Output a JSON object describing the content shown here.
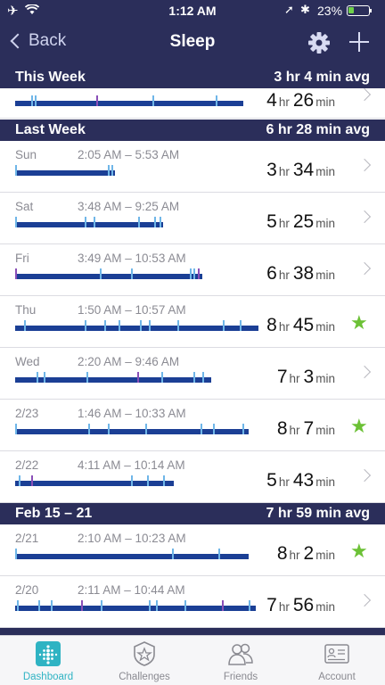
{
  "status_bar": {
    "time": "1:12 AM",
    "battery_pct": "23%",
    "battery_level": 0.23
  },
  "nav": {
    "back_label": "Back",
    "title": "Sleep"
  },
  "this_week": {
    "label": "This Week",
    "avg": "3 hr 4 min avg",
    "row": {
      "hours": "4",
      "minutes": "26"
    }
  },
  "last_week": {
    "label": "Last Week",
    "avg": "6 hr 28 min avg",
    "rows": [
      {
        "day": "Sun",
        "range": "2:05 AM – 5:53 AM",
        "hours": "3",
        "minutes": "34",
        "star": false
      },
      {
        "day": "Sat",
        "range": "3:48 AM – 9:25 AM",
        "hours": "5",
        "minutes": "25",
        "star": false
      },
      {
        "day": "Fri",
        "range": "3:49 AM – 10:53 AM",
        "hours": "6",
        "minutes": "38",
        "star": false
      },
      {
        "day": "Thu",
        "range": "1:50 AM – 10:57 AM",
        "hours": "8",
        "minutes": "45",
        "star": true
      },
      {
        "day": "Wed",
        "range": "2:20 AM – 9:46 AM",
        "hours": "7",
        "minutes": "3",
        "star": false
      },
      {
        "day": "2/23",
        "range": "1:46 AM – 10:33 AM",
        "hours": "8",
        "minutes": "7",
        "star": true
      },
      {
        "day": "2/22",
        "range": "4:11 AM – 10:14 AM",
        "hours": "5",
        "minutes": "43",
        "star": false
      }
    ]
  },
  "feb_week": {
    "label": "Feb 15 – 21",
    "avg": "7 hr 59 min avg",
    "rows": [
      {
        "day": "2/21",
        "range": "2:10 AM – 10:23 AM",
        "hours": "8",
        "minutes": "2",
        "star": true
      },
      {
        "day": "2/20",
        "range": "2:11 AM – 10:44 AM",
        "hours": "7",
        "minutes": "56",
        "star": false
      }
    ]
  },
  "units": {
    "hr": "hr",
    "min": "min"
  },
  "tabs": [
    {
      "label": "Dashboard",
      "icon": "dashboard-icon",
      "active": true
    },
    {
      "label": "Challenges",
      "icon": "challenges-badge-icon",
      "active": false
    },
    {
      "label": "Friends",
      "icon": "friends-icon",
      "active": false
    },
    {
      "label": "Account",
      "icon": "account-card-icon",
      "active": false
    }
  ],
  "colors": {
    "nav": "#2b2e5a",
    "sleep_bar": "#1b3f95",
    "restless": "#6fb6e8",
    "awake": "#8a4fb8",
    "star": "#6cc136",
    "tab_active": "#2fb3c3"
  }
}
